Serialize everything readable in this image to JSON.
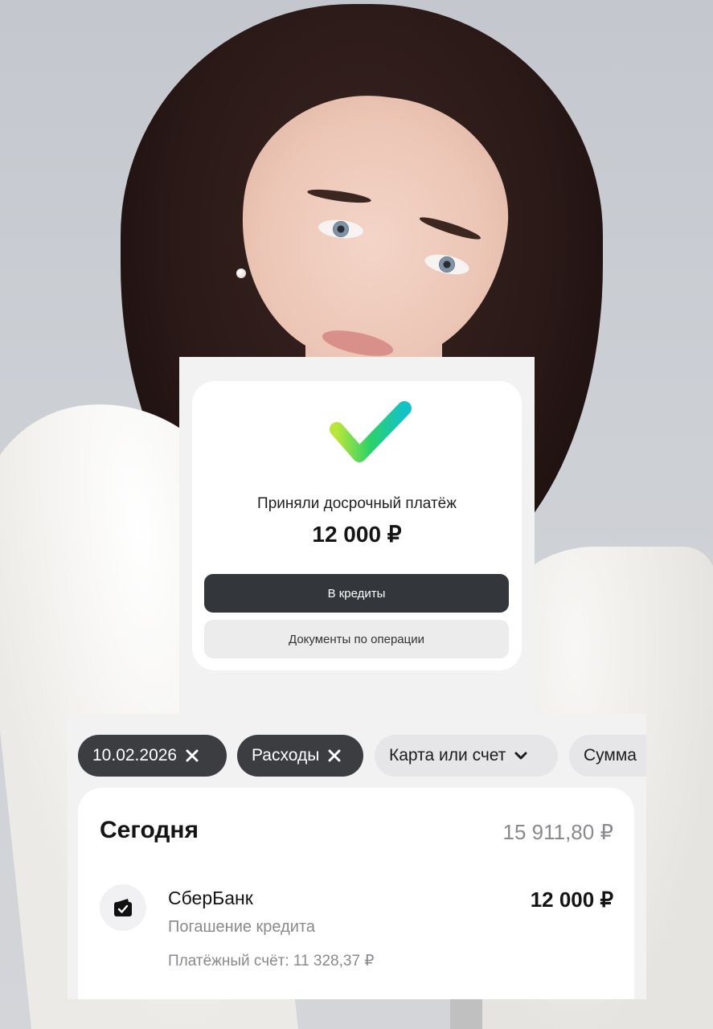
{
  "confirmation": {
    "title": "Приняли досрочный платёж",
    "amount": "12 000 ₽",
    "primary_button": "В кредиты",
    "secondary_button": "Документы по операции",
    "icon": "checkmark-icon",
    "check_gradient": [
      "#b9e63a",
      "#2bd16a",
      "#12c2c8"
    ]
  },
  "filters": [
    {
      "label": "10.02.2026",
      "active": true,
      "icon": "close-icon"
    },
    {
      "label": "Расходы",
      "active": true,
      "icon": "close-icon"
    },
    {
      "label": "Карта или счет",
      "active": false,
      "icon": "chevron-down-icon"
    },
    {
      "label": "Сумма",
      "active": false
    }
  ],
  "operations": {
    "day_label": "Сегодня",
    "day_total": "15 911,80 ₽",
    "items": [
      {
        "name": "СберБанк",
        "subtitle": "Погашение кредита",
        "account": "Платёжный счёт: 11 328,37 ₽",
        "amount": "12 000 ₽",
        "icon": "wallet-check-icon"
      }
    ]
  },
  "colors": {
    "dark_button": "#33363b",
    "muted_text": "#8a8a8e",
    "panel_bg": "#f2f2f2"
  }
}
